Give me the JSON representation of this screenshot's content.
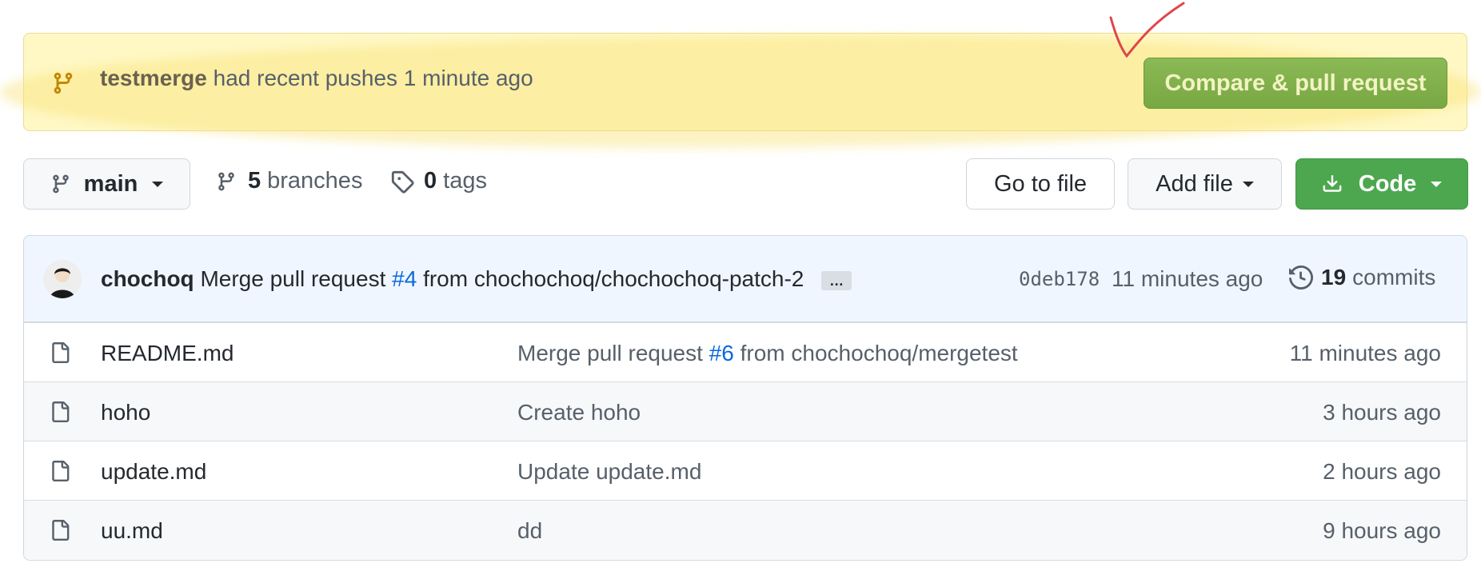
{
  "banner": {
    "branch": "testmerge",
    "text": "had recent pushes 1 minute ago",
    "button_label": "Compare & pull request"
  },
  "toolbar": {
    "branch_label": "main",
    "branches_count": "5",
    "branches_label": "branches",
    "tags_count": "0",
    "tags_label": "tags",
    "goto_label": "Go to file",
    "addfile_label": "Add file",
    "code_label": "Code"
  },
  "latest_commit": {
    "author": "chochoq",
    "message_pre": "Merge pull request",
    "pr_link": "#4",
    "message_post": "from chochochoq/chochochoq-patch-2",
    "ellipsis": "…",
    "sha": "0deb178",
    "time": "11 minutes ago",
    "commits_count": "19",
    "commits_label": "commits"
  },
  "files": [
    {
      "name": "README.md",
      "msg_pre": "Merge pull request",
      "msg_link": "#6",
      "msg_post": "from chochochoq/mergetest",
      "time": "11 minutes ago"
    },
    {
      "name": "hoho",
      "msg_pre": "Create hoho",
      "msg_link": "",
      "msg_post": "",
      "time": "3 hours ago"
    },
    {
      "name": "update.md",
      "msg_pre": "Update update.md",
      "msg_link": "",
      "msg_post": "",
      "time": "2 hours ago"
    },
    {
      "name": "uu.md",
      "msg_pre": "dd",
      "msg_link": "",
      "msg_post": "",
      "time": "9 hours ago"
    }
  ],
  "colors": {
    "accent_link": "#0969da",
    "code_button": "#4ca74f",
    "compare_button": "#7fb04a",
    "banner_bg": "#fff8c5",
    "annotation": "#e0454a"
  },
  "icons": [
    "git-branch-icon",
    "tag-icon",
    "download-icon",
    "history-icon",
    "file-icon",
    "checkmark-annotation"
  ]
}
